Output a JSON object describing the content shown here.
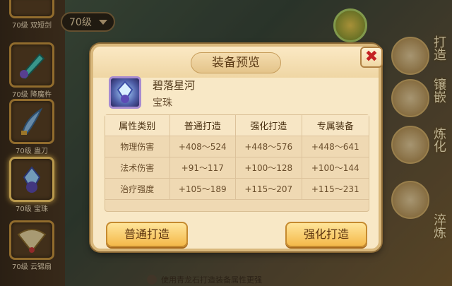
{
  "filter": {
    "level": "70级"
  },
  "equipment_list": [
    {
      "label": "70级 双短剑"
    },
    {
      "label": "70级 降魔杵"
    },
    {
      "label": "70级 蛊刀"
    },
    {
      "label": "70级 宝珠"
    },
    {
      "label": "70级 云锦扇"
    }
  ],
  "right_menu": [
    "打造",
    "镶嵌",
    "炼化",
    "淬炼"
  ],
  "hint": "使用青龙石打造装备属性更强",
  "dialog": {
    "title": "装备预览",
    "close_label": "✖",
    "item": {
      "name": "碧落星河",
      "type": "宝珠"
    },
    "table": {
      "headers": [
        "属性类别",
        "普通打造",
        "强化打造",
        "专属装备"
      ],
      "rows": [
        [
          "物理伤害",
          "+408～524",
          "+448～576",
          "+448～641"
        ],
        [
          "法术伤害",
          "+91～117",
          "+100～128",
          "+100～144"
        ],
        [
          "治疗强度",
          "+105～189",
          "+115～207",
          "+115～231"
        ]
      ]
    },
    "buttons": {
      "normal": "普通打造",
      "enhance": "强化打造"
    }
  },
  "colors": {
    "accent": "#f4b94a",
    "close": "#c42222",
    "text": "#4b3213"
  }
}
